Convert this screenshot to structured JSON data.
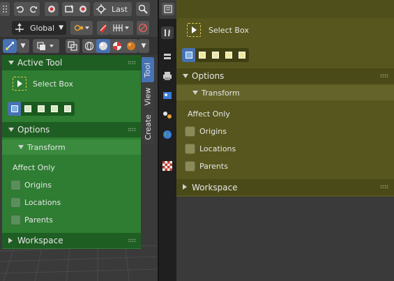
{
  "header": {
    "orientation_label": "Global",
    "last_label": "Last"
  },
  "active_tool": {
    "section_title": "Active Tool",
    "tool_name": "Select Box"
  },
  "options": {
    "section_title": "Options",
    "transform_title": "Transform",
    "affect_only_label": "Affect Only",
    "checkboxes": [
      "Origins",
      "Locations",
      "Parents"
    ]
  },
  "workspace": {
    "section_title": "Workspace"
  },
  "side_tabs": [
    "Tool",
    "View",
    "Create"
  ],
  "colors": {
    "green_panel": "#2e7d32",
    "yellow_panel": "#56561e",
    "accent": "#4772b3"
  }
}
